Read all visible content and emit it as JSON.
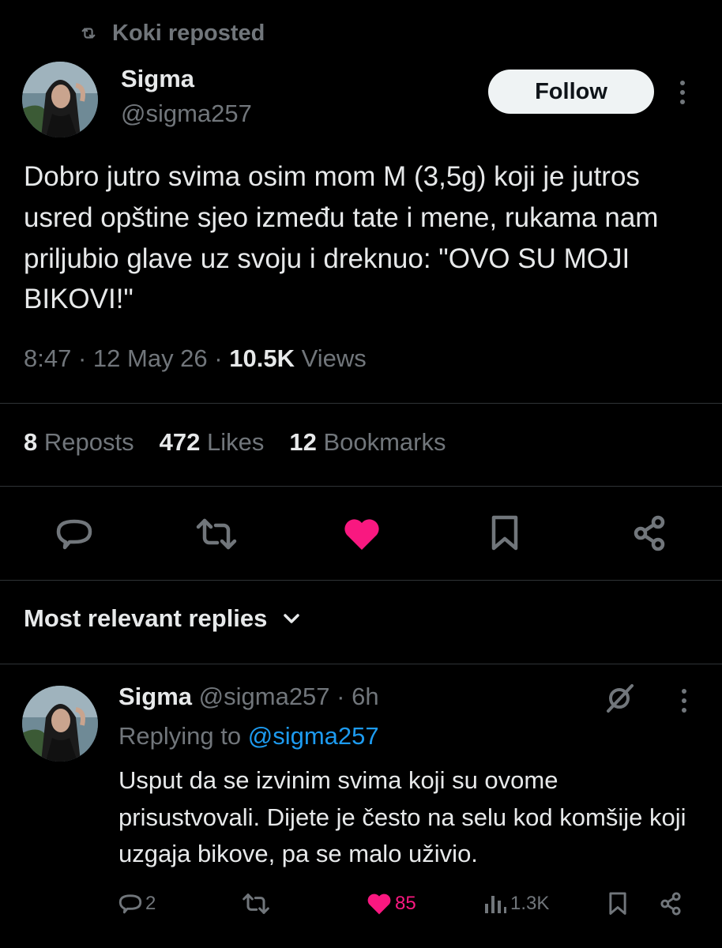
{
  "repost": {
    "icon": "repost-icon",
    "label": "Koki reposted"
  },
  "tweet": {
    "avatar": "avatar-sigma",
    "display_name": "Sigma",
    "handle": "@sigma257",
    "follow_label": "Follow",
    "more_icon": "more-vertical-icon",
    "text": "Dobro jutro svima osim mom M (3,5g) koji je jutros usred opštine sjeo između tate i mene, rukama nam priljubio glave uz svoju i dreknuo: \"OVO SU MOJI BIKOVI!\"",
    "time": "8:47",
    "date": "12 May 26",
    "views_count": "10.5K",
    "views_label": "Views",
    "stats": {
      "reposts_count": "8",
      "reposts_label": "Reposts",
      "likes_count": "472",
      "likes_label": "Likes",
      "bookmarks_count": "12",
      "bookmarks_label": "Bookmarks"
    },
    "actions": [
      "reply-icon",
      "repost-icon",
      "heart-filled-icon",
      "bookmark-icon",
      "share-icon"
    ]
  },
  "replies_header": {
    "label": "Most relevant replies",
    "icon": "chevron-down-icon"
  },
  "reply": {
    "avatar": "avatar-sigma",
    "display_name": "Sigma",
    "handle": "@sigma257",
    "time": "· 6h",
    "replying_to_label": "Replying to",
    "replying_to_handle": "@sigma257",
    "text": "Usput da se izvinim svima koji su ovome prisustvovali. Dijete je često na selu kod komšije koji uzgaja bikove, pa se malo uživio.",
    "actions": {
      "reply_count": "2",
      "like_count": "85",
      "views_count": "1.3K"
    }
  },
  "colors": {
    "background": "#000000",
    "text": "#e7e9ea",
    "muted": "#71767b",
    "like": "#f91880",
    "link": "#1d9bf0",
    "divider": "#2f3336"
  }
}
